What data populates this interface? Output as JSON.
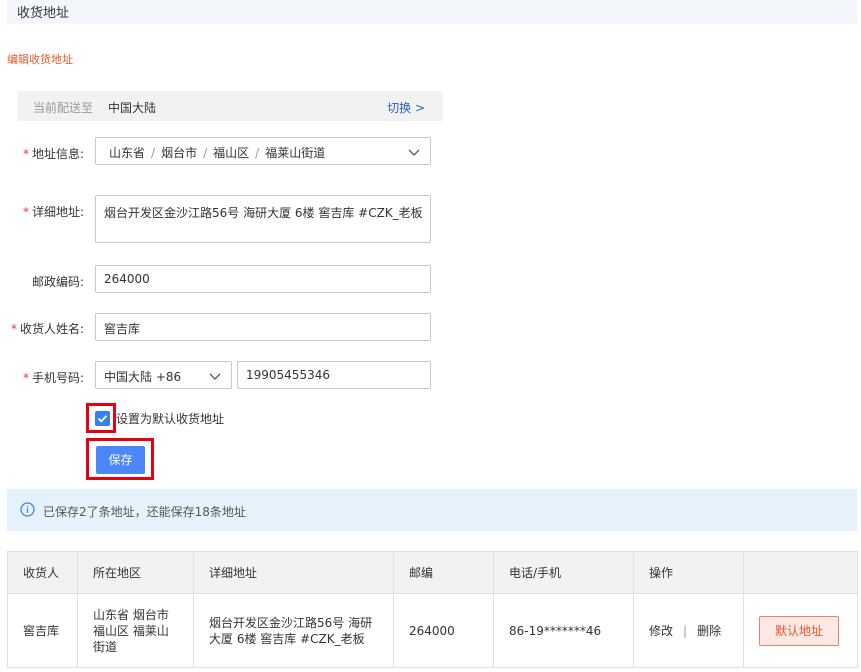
{
  "header": {
    "title": "收货地址"
  },
  "form": {
    "section_title": "编辑收货地址",
    "delivery": {
      "label": "当前配送至",
      "value": "中国大陆",
      "switch_label": "切换 >"
    },
    "address_info": {
      "label": "地址信息:",
      "province": "山东省",
      "city": "烟台市",
      "district": "福山区",
      "street": "福莱山街道",
      "separator": "/"
    },
    "detail": {
      "label": "详细地址:",
      "value": "烟台开发区金沙江路56号 海研大厦 6楼 窖吉库 #CZK_老板"
    },
    "postcode": {
      "label": "邮政编码:",
      "value": "264000"
    },
    "receiver": {
      "label": "收货人姓名:",
      "value": "窖吉库"
    },
    "phone": {
      "label": "手机号码:",
      "region": "中国大陆 +86",
      "value": "19905455346"
    },
    "required_mark": "*",
    "default_checkbox": {
      "label": "设置为默认收货地址",
      "checked": true
    },
    "save_label": "保存"
  },
  "info": {
    "message": "已保存2了条地址，还能保存18条地址"
  },
  "table": {
    "headers": [
      "收货人",
      "所在地区",
      "详细地址",
      "邮编",
      "电话/手机",
      "操作",
      ""
    ],
    "rows": [
      {
        "name": "窖吉库",
        "region": "山东省 烟台市 福山区 福莱山 街道",
        "address": "烟台开发区金沙江路56号 海研大厦 6楼 窖吉库 #CZK_老板",
        "postcode": "264000",
        "phone": "86-19*******46",
        "edit": "修改",
        "op_separator": "|",
        "delete": "删除",
        "default_label": "默认地址"
      }
    ]
  },
  "colors": {
    "accent": "#4b87f7",
    "required": "#e4393c",
    "highlight_box": "#e60012",
    "info_bg": "#e6f2fb",
    "link": "#2b63b5"
  }
}
